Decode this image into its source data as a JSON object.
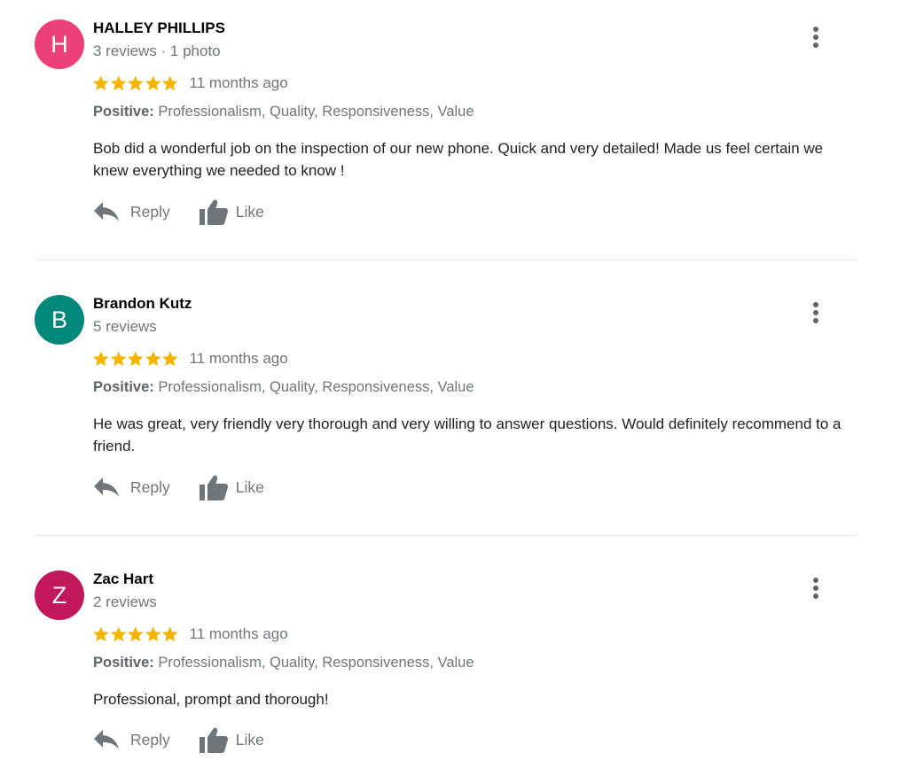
{
  "actions": {
    "reply_label": "Reply",
    "like_label": "Like"
  },
  "colors": {
    "star": "#f4b400",
    "text_secondary": "#70757a"
  },
  "reviews": [
    {
      "initial": "H",
      "avatar_color": "#ec407a",
      "name": "HALLEY PHILLIPS",
      "meta": "3 reviews · 1 photo",
      "rating": 5,
      "age": "11 months ago",
      "tags_label": "Positive:",
      "tags": "Professionalism, Quality, Responsiveness, Value",
      "text": "Bob did a wonderful job on the inspection of our new phone. Quick and very detailed! Made us feel certain we knew everything we needed to know !"
    },
    {
      "initial": "B",
      "avatar_color": "#00897b",
      "name": "Brandon Kutz",
      "meta": "5 reviews",
      "rating": 5,
      "age": "11 months ago",
      "tags_label": "Positive:",
      "tags": "Professionalism, Quality, Responsiveness, Value",
      "text": "He was great, very friendly very thorough and very willing to answer questions. Would definitely recommend to a friend."
    },
    {
      "initial": "Z",
      "avatar_color": "#c2185b",
      "name": "Zac Hart",
      "meta": "2 reviews",
      "rating": 5,
      "age": "11 months ago",
      "tags_label": "Positive:",
      "tags": "Professionalism, Quality, Responsiveness, Value",
      "text": "Professional, prompt and thorough!"
    }
  ]
}
